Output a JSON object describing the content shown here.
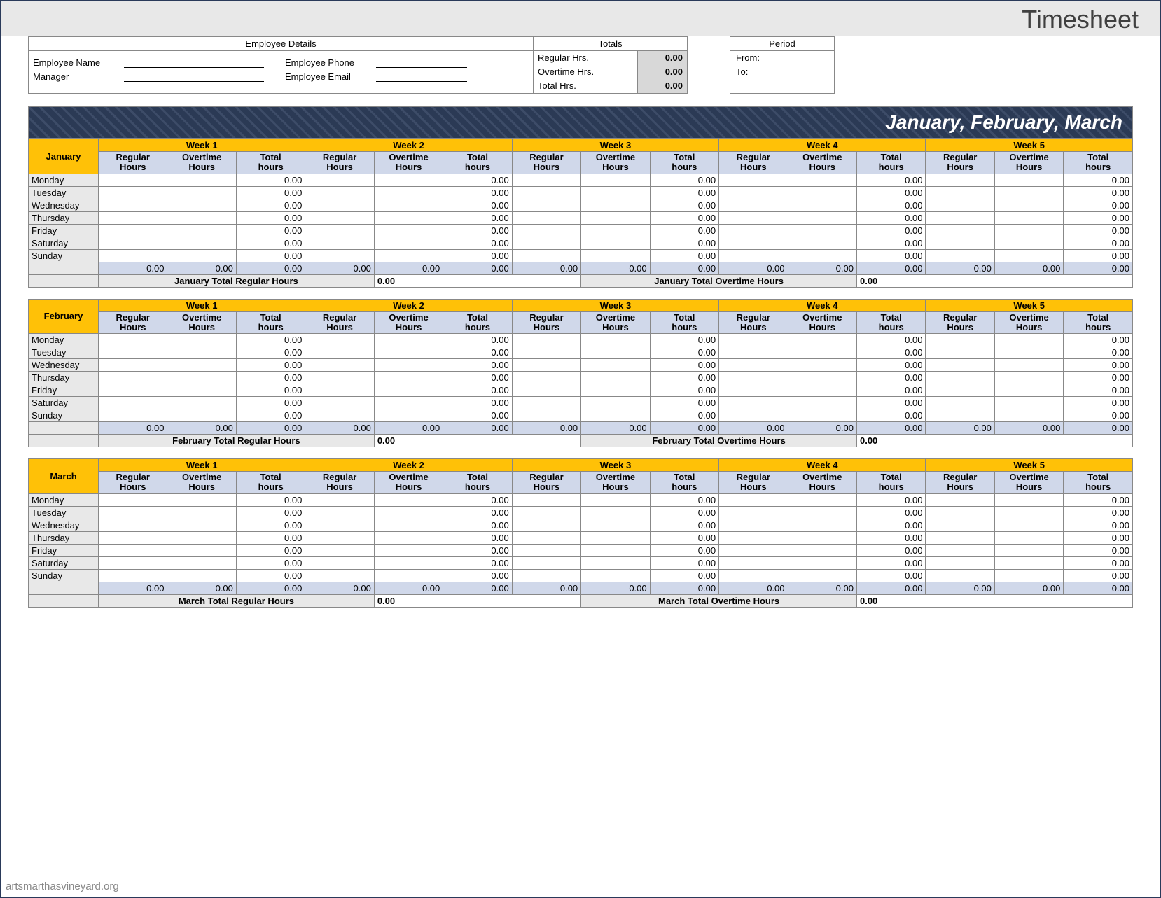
{
  "title": "Timesheet",
  "employee_details": {
    "header": "Employee Details",
    "name_label": "Employee Name",
    "manager_label": "Manager",
    "phone_label": "Employee Phone",
    "email_label": "Employee Email"
  },
  "totals": {
    "header": "Totals",
    "regular_label": "Regular Hrs.",
    "regular_value": "0.00",
    "overtime_label": "Overtime Hrs.",
    "overtime_value": "0.00",
    "total_label": "Total Hrs.",
    "total_value": "0.00"
  },
  "period": {
    "header": "Period",
    "from_label": "From:",
    "to_label": "To:"
  },
  "quarter_banner": "January, February, March",
  "weeks": [
    "Week 1",
    "Week 2",
    "Week 3",
    "Week 4",
    "Week 5"
  ],
  "sub_headers": {
    "regular": "Regular Hours",
    "overtime": "Overtime Hours",
    "total": "Total hours"
  },
  "days": [
    "Monday",
    "Tuesday",
    "Wednesday",
    "Thursday",
    "Friday",
    "Saturday",
    "Sunday"
  ],
  "zero": "0.00",
  "months": [
    {
      "name": "January",
      "total_regular_label": "January Total Regular Hours",
      "total_regular_value": "0.00",
      "total_overtime_label": "January Total Overtime Hours",
      "total_overtime_value": "0.00"
    },
    {
      "name": "February",
      "total_regular_label": "February Total Regular Hours",
      "total_regular_value": "0.00",
      "total_overtime_label": "February Total Overtime Hours",
      "total_overtime_value": "0.00"
    },
    {
      "name": "March",
      "total_regular_label": "March Total Regular Hours",
      "total_regular_value": "0.00",
      "total_overtime_label": "March Total Overtime Hours",
      "total_overtime_value": "0.00"
    }
  ],
  "watermark": "artsmarthasvineyard.org"
}
